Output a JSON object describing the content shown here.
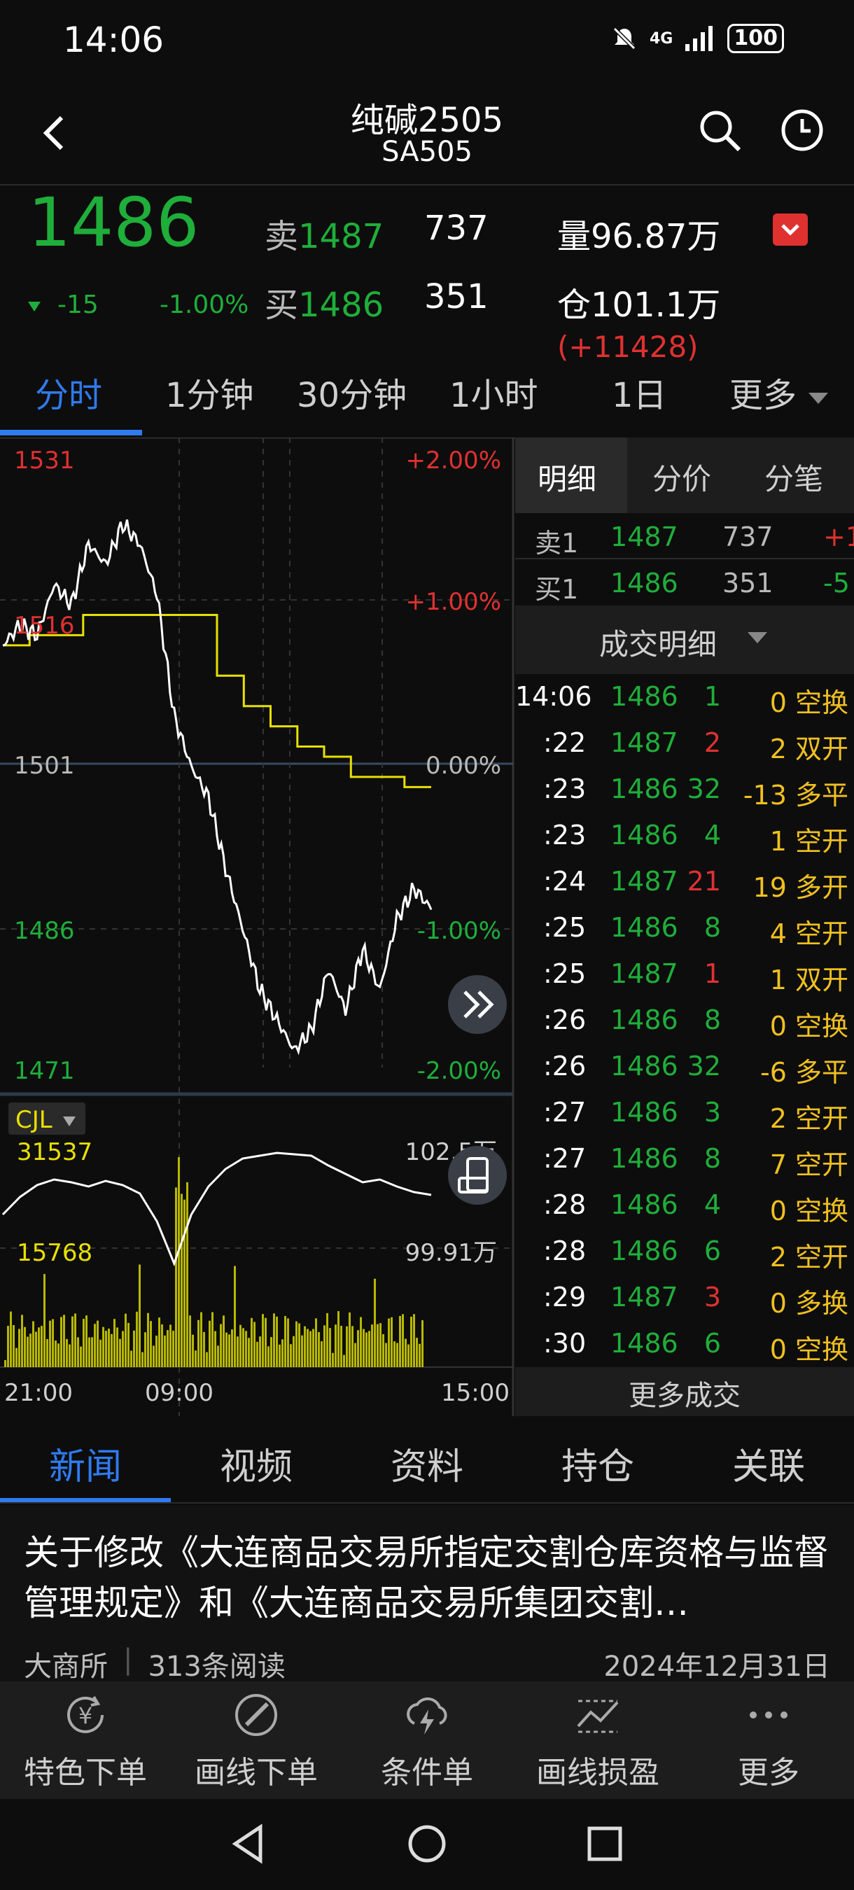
{
  "status_bar": {
    "time": "14:06",
    "network": "4G",
    "battery": "100"
  },
  "header": {
    "title": "纯碱2505",
    "subtitle": "SA505"
  },
  "quote": {
    "last_price": "1486",
    "change": "-15",
    "change_pct": "-1.00%",
    "ask_label": "卖",
    "ask_price": "1487",
    "ask_volume": "737",
    "bid_label": "买",
    "bid_price": "1486",
    "bid_volume": "351",
    "volume": "量96.87万",
    "open_interest": "仓101.1万",
    "oi_change": "(+11428)"
  },
  "period_tabs": [
    "分时",
    "1分钟",
    "30分钟",
    "1小时",
    "1日",
    "更多"
  ],
  "chart_labels": {
    "y_left": [
      "1531",
      "1516",
      "1501",
      "1486",
      "1471"
    ],
    "y_right": [
      "+2.00%",
      "+1.00%",
      "0.00%",
      "-1.00%",
      "-2.00%"
    ],
    "indicator": "CJL",
    "vol_left": [
      "31537",
      "15768"
    ],
    "vol_right": [
      "102.5万",
      "99.91万"
    ],
    "x": [
      "21:00",
      "09:00",
      "15:00"
    ]
  },
  "chart_data": {
    "type": "line",
    "ylim": [
      1471,
      1531
    ],
    "x": [
      "21:00",
      "09:00",
      "15:00"
    ],
    "series": [
      {
        "values": [
          1512,
          1514,
          1513,
          1518,
          1516,
          1522,
          1520,
          1524,
          1522,
          1517,
          1505,
          1500,
          1497,
          1490,
          1484,
          1478,
          1475,
          1472,
          1474,
          1480,
          1476,
          1482,
          1478,
          1485,
          1488,
          1486
        ]
      },
      {
        "values": [
          1512,
          1513,
          1513,
          1515,
          1515,
          1515,
          1515,
          1515,
          1509,
          1506,
          1504,
          1502,
          1501,
          1499,
          1499,
          1498
        ]
      }
    ]
  },
  "right_panel": {
    "tabs": [
      "明细",
      "分价",
      "分笔"
    ],
    "orderbook": [
      {
        "label": "卖1",
        "price": "1487",
        "vol": "737",
        "chg": "+1"
      },
      {
        "label": "买1",
        "price": "1486",
        "vol": "351",
        "chg": "-5"
      }
    ],
    "trade_header": "成交明细",
    "trades": [
      {
        "t": "14:06",
        "p": "1486",
        "v": "1",
        "oi": "0",
        "k": "空换",
        "pc": "g",
        "vc": "g"
      },
      {
        "t": ":22",
        "p": "1487",
        "v": "2",
        "oi": "2",
        "k": "双开",
        "pc": "g",
        "vc": "r"
      },
      {
        "t": ":23",
        "p": "1486",
        "v": "32",
        "oi": "-13",
        "k": "多平",
        "pc": "g",
        "vc": "g"
      },
      {
        "t": ":23",
        "p": "1486",
        "v": "4",
        "oi": "1",
        "k": "空开",
        "pc": "g",
        "vc": "g"
      },
      {
        "t": ":24",
        "p": "1487",
        "v": "21",
        "oi": "19",
        "k": "多开",
        "pc": "g",
        "vc": "r"
      },
      {
        "t": ":25",
        "p": "1486",
        "v": "8",
        "oi": "4",
        "k": "空开",
        "pc": "g",
        "vc": "g"
      },
      {
        "t": ":25",
        "p": "1487",
        "v": "1",
        "oi": "1",
        "k": "双开",
        "pc": "g",
        "vc": "r"
      },
      {
        "t": ":26",
        "p": "1486",
        "v": "8",
        "oi": "0",
        "k": "空换",
        "pc": "g",
        "vc": "g"
      },
      {
        "t": ":26",
        "p": "1486",
        "v": "32",
        "oi": "-6",
        "k": "多平",
        "pc": "g",
        "vc": "g"
      },
      {
        "t": ":27",
        "p": "1486",
        "v": "3",
        "oi": "2",
        "k": "空开",
        "pc": "g",
        "vc": "g"
      },
      {
        "t": ":27",
        "p": "1486",
        "v": "8",
        "oi": "7",
        "k": "空开",
        "pc": "g",
        "vc": "g"
      },
      {
        "t": ":28",
        "p": "1486",
        "v": "4",
        "oi": "0",
        "k": "空换",
        "pc": "g",
        "vc": "g"
      },
      {
        "t": ":28",
        "p": "1486",
        "v": "6",
        "oi": "2",
        "k": "空开",
        "pc": "g",
        "vc": "g"
      },
      {
        "t": ":29",
        "p": "1487",
        "v": "3",
        "oi": "0",
        "k": "多换",
        "pc": "g",
        "vc": "r"
      },
      {
        "t": ":30",
        "p": "1486",
        "v": "6",
        "oi": "0",
        "k": "空换",
        "pc": "g",
        "vc": "g"
      }
    ],
    "more_trades": "更多成交"
  },
  "news_tabs": [
    "新闻",
    "视频",
    "资料",
    "持仓",
    "关联"
  ],
  "news": {
    "title": "关于修改《大连商品交易所指定交割仓库资格与监督管理规定》和《大连商品交易所集团交割…",
    "source": "大商所",
    "reads": "313条阅读",
    "date": "2024年12月31日"
  },
  "toolbar": [
    "特色下单",
    "画线下单",
    "条件单",
    "画线损盈",
    "更多"
  ],
  "colors": {
    "up": "#e03131",
    "down": "#1fae3a",
    "accent": "#2f7bf0",
    "avg_line": "#e8e000"
  }
}
